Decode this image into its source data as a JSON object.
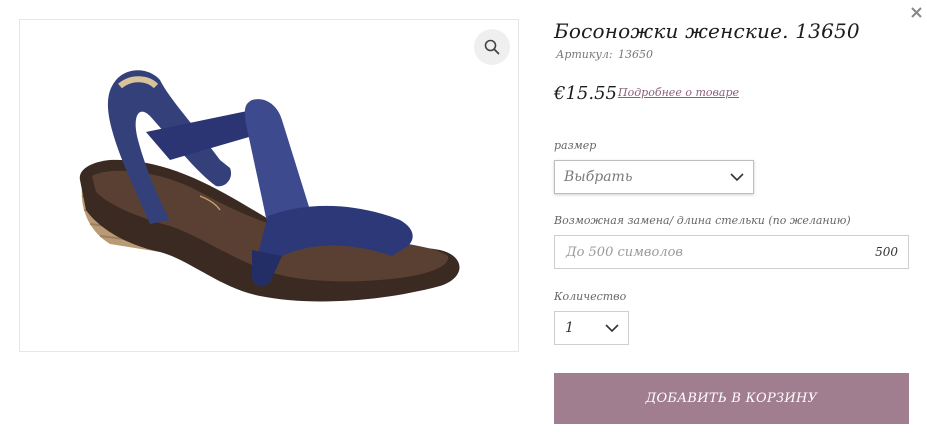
{
  "product": {
    "title": "Босоножки женские. 13650",
    "article_label": "Артикул:",
    "article_value": "13650",
    "price": "€15.55",
    "details_link": "Подробнее о товаре",
    "image_icon": "sandal-product-photo"
  },
  "options": {
    "size": {
      "label": "размер",
      "selected": "Выбрать"
    },
    "insole": {
      "label": "Возможная замена/ длина стельки (по желанию)",
      "placeholder": "До 500 символов",
      "counter": "500"
    },
    "quantity": {
      "label": "Количество",
      "selected": "1"
    }
  },
  "actions": {
    "add_to_cart": "ДОБАВИТЬ В КОРЗИНУ"
  },
  "icons": {
    "zoom": "zoom-icon",
    "close": "close-icon",
    "chevron": "chevron-down-icon"
  },
  "colors": {
    "accent_button": "#a17e8f",
    "link": "#8b5e78",
    "sandal_strap": "#3b4a8c"
  }
}
